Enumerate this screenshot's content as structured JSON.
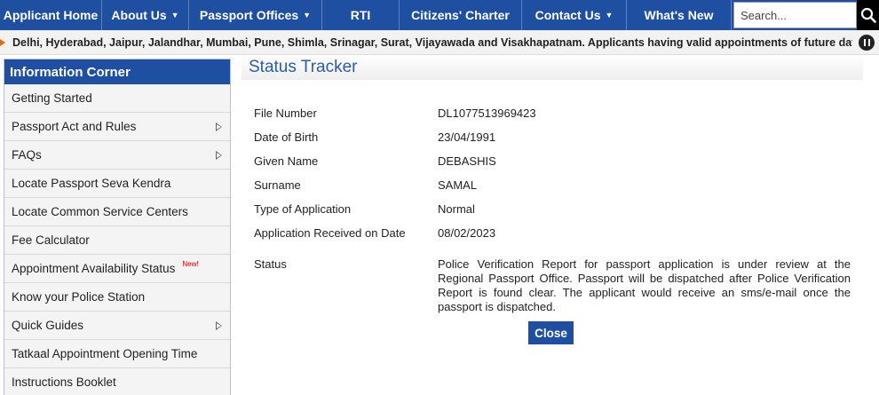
{
  "nav": {
    "items": [
      {
        "label": "Applicant Home",
        "dropdown": false,
        "width": 115
      },
      {
        "label": "About Us",
        "dropdown": true,
        "width": 98
      },
      {
        "label": "Passport Offices",
        "dropdown": true,
        "width": 150
      },
      {
        "label": "RTI",
        "dropdown": false,
        "width": 87
      },
      {
        "label": "Citizens' Charter",
        "dropdown": false,
        "width": 138
      },
      {
        "label": "Contact Us",
        "dropdown": true,
        "width": 118
      },
      {
        "label": "What's New",
        "dropdown": false,
        "width": 118
      }
    ],
    "search_placeholder": "Search..."
  },
  "ticker": {
    "text": "Delhi, Hyderabad, Jaipur, Jalandhar, Mumbai, Pune, Shimla, Srinagar, Surat, Vijayawada and Visakhapatnam. Applicants having valid appointments of future date may"
  },
  "sidebar": {
    "title": "Information Corner",
    "items": [
      {
        "label": "Getting Started",
        "arrow": false,
        "badge": ""
      },
      {
        "label": "Passport Act and Rules",
        "arrow": true,
        "badge": ""
      },
      {
        "label": "FAQs",
        "arrow": true,
        "badge": ""
      },
      {
        "label": "Locate Passport Seva Kendra",
        "arrow": false,
        "badge": ""
      },
      {
        "label": "Locate Common Service Centers",
        "arrow": false,
        "badge": ""
      },
      {
        "label": "Fee Calculator",
        "arrow": false,
        "badge": ""
      },
      {
        "label": "Appointment Availability Status",
        "arrow": false,
        "badge": "New!"
      },
      {
        "label": "Know your Police Station",
        "arrow": false,
        "badge": ""
      },
      {
        "label": "Quick Guides",
        "arrow": true,
        "badge": ""
      },
      {
        "label": "Tatkaal Appointment Opening Time",
        "arrow": false,
        "badge": ""
      },
      {
        "label": "Instructions Booklet",
        "arrow": false,
        "badge": ""
      }
    ]
  },
  "main": {
    "title": "Status Tracker",
    "fields": [
      {
        "label": "File Number",
        "value": "DL1077513969423"
      },
      {
        "label": "Date of Birth",
        "value": "23/04/1991"
      },
      {
        "label": "Given Name",
        "value": "DEBASHIS"
      },
      {
        "label": "Surname",
        "value": "SAMAL"
      },
      {
        "label": "Type of Application",
        "value": "Normal"
      },
      {
        "label": "Application Received on Date",
        "value": "08/02/2023"
      }
    ],
    "status_label": "Status",
    "status_value": "Police Verification Report for passport application is under review at the Regional Passport Office. Passport will be dispatched after Police Verification Report is found clear. The applicant would receive an sms/e-mail once the passport is dispatched.",
    "close_label": "Close"
  }
}
